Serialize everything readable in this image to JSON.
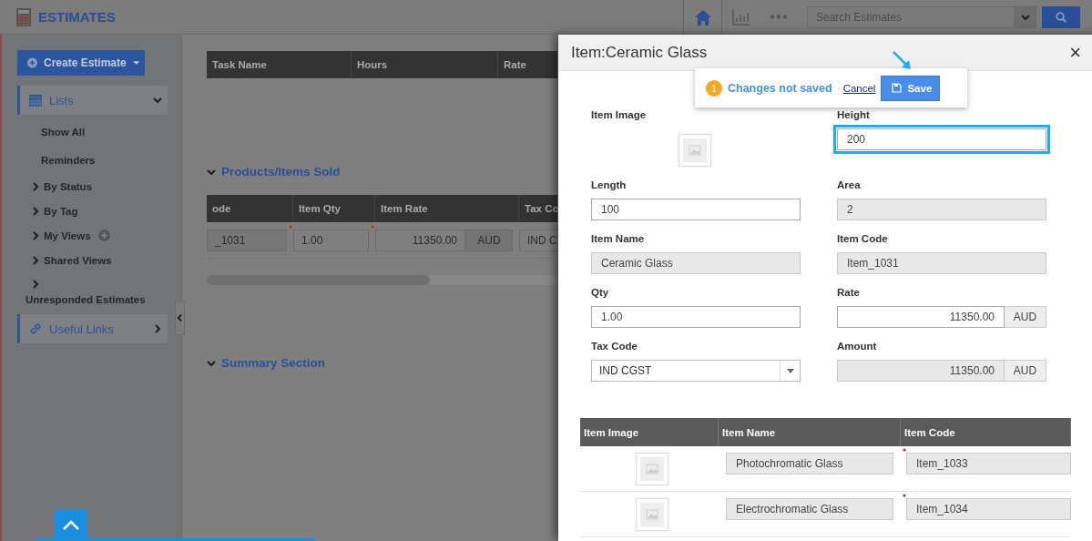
{
  "header": {
    "title": "ESTIMATES",
    "search": {
      "placeholder": "Search Estimates"
    }
  },
  "sidebar": {
    "create_button": "Create Estimate",
    "sections": [
      {
        "label": "Lists",
        "expanded": true,
        "children": [
          {
            "label": "Show All",
            "kind": "plain"
          },
          {
            "label": "Reminders",
            "kind": "plain"
          },
          {
            "label": "By Status",
            "kind": "group"
          },
          {
            "label": "By Tag",
            "kind": "group"
          },
          {
            "label": "My Views",
            "kind": "group",
            "addable": true
          },
          {
            "label": "Shared Views",
            "kind": "group"
          },
          {
            "label": "Unresponded Estimates",
            "kind": "wrapped"
          }
        ]
      },
      {
        "label": "Useful Links",
        "expanded": false
      }
    ]
  },
  "main": {
    "task_table": {
      "columns": [
        "Task Name",
        "Hours",
        "Rate"
      ]
    },
    "products": {
      "title": "Products/Items Sold",
      "expanded": true,
      "columns": [
        "ode",
        "Item Qty",
        "Item Rate",
        "Tax Co"
      ],
      "row": [
        {
          "value": "_1031",
          "kind": "readonly",
          "required": false
        },
        {
          "value": "1.00",
          "kind": "input",
          "required": true
        },
        {
          "value": "11350.00",
          "kind": "currency",
          "currency": "AUD",
          "required": true
        },
        {
          "value": "IND C",
          "kind": "input",
          "required": false
        }
      ]
    },
    "summary": {
      "title": "Summary Section",
      "expanded": true
    }
  },
  "modal": {
    "title": "Item:Ceramic Glass",
    "close": "×",
    "unsaved": {
      "count": "1",
      "message": "Changes not saved",
      "cancel": "Cancel",
      "save": "Save"
    },
    "fields": [
      {
        "label": "Item Image",
        "kind": "image"
      },
      {
        "label": "Height",
        "kind": "input",
        "value": "200",
        "highlighted": true
      },
      {
        "label": "Length",
        "kind": "input",
        "value": "100",
        "highlighted": false
      },
      {
        "label": "Area",
        "kind": "readonly",
        "value": "2"
      },
      {
        "label": "Item Name",
        "kind": "readonly",
        "value": "Ceramic Glass"
      },
      {
        "label": "Item Code",
        "kind": "readonly",
        "value": "Item_1031"
      },
      {
        "label": "Qty",
        "kind": "input",
        "value": "1.00",
        "highlighted": false
      },
      {
        "label": "Rate",
        "kind": "currency",
        "value": "11350.00",
        "currency": "AUD",
        "readonly": false
      },
      {
        "label": "Tax Code",
        "kind": "select",
        "value": "IND CGST"
      },
      {
        "label": "Amount",
        "kind": "currency",
        "value": "11350.00",
        "currency": "AUD",
        "readonly": true
      }
    ],
    "table": {
      "columns": [
        "Item Image",
        "Item Name",
        "Item Code"
      ],
      "rows": [
        {
          "name": "Photochromatic Glass",
          "code": "Item_1033",
          "required": true
        },
        {
          "name": "Electrochromatic Glass",
          "code": "Item_1034",
          "required": true
        }
      ]
    }
  }
}
